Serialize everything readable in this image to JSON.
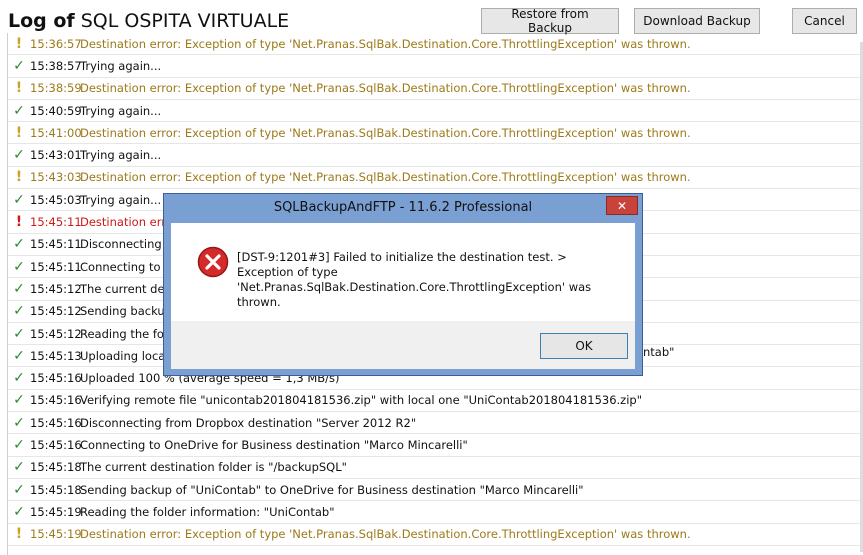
{
  "header": {
    "title_bold": "Log of",
    "title_rest": "SQL OSPITA VIRTUALE",
    "restore_label": "Restore from Backup",
    "download_label": "Download Backup",
    "cancel_label": "Cancel"
  },
  "log": [
    {
      "status": "warning",
      "time": "15:36:57",
      "text": "Destination error: Exception of type 'Net.Pranas.SqlBak.Destination.Core.ThrottlingException' was thrown."
    },
    {
      "status": "ok",
      "time": "15:38:57",
      "text": "Trying again..."
    },
    {
      "status": "warning",
      "time": "15:38:59",
      "text": "Destination error: Exception of type 'Net.Pranas.SqlBak.Destination.Core.ThrottlingException' was thrown."
    },
    {
      "status": "ok",
      "time": "15:40:59",
      "text": "Trying again..."
    },
    {
      "status": "warning",
      "time": "15:41:00",
      "text": "Destination error: Exception of type 'Net.Pranas.SqlBak.Destination.Core.ThrottlingException' was thrown."
    },
    {
      "status": "ok",
      "time": "15:43:01",
      "text": "Trying again..."
    },
    {
      "status": "warning",
      "time": "15:43:03",
      "text": "Destination error: Exception of type 'Net.Pranas.SqlBak.Destination.Core.ThrottlingException' was thrown."
    },
    {
      "status": "ok",
      "time": "15:45:03",
      "text": "Trying again..."
    },
    {
      "status": "error",
      "time": "15:45:11",
      "text": "Destination erro"
    },
    {
      "status": "ok",
      "time": "15:45:11",
      "text": "Disconnecting f"
    },
    {
      "status": "ok",
      "time": "15:45:11",
      "text": "Connecting to D"
    },
    {
      "status": "ok",
      "time": "15:45:12",
      "text": "The current des"
    },
    {
      "status": "ok",
      "time": "15:45:12",
      "text": "Sending backup"
    },
    {
      "status": "ok",
      "time": "15:45:12",
      "text": "Reading the fold"
    },
    {
      "status": "ok",
      "time": "15:45:13",
      "text": "Uploading loca"
    },
    {
      "status": "ok",
      "time": "15:45:16",
      "text": "Uploaded 100 % (average speed = 1,3 MB/s)"
    },
    {
      "status": "ok",
      "time": "15:45:16",
      "text": "Verifying remote file \"unicontab201804181536.zip\" with local one \"UniContab201804181536.zip\""
    },
    {
      "status": "ok",
      "time": "15:45:16",
      "text": "Disconnecting from Dropbox destination \"Server 2012 R2\""
    },
    {
      "status": "ok",
      "time": "15:45:16",
      "text": "Connecting to OneDrive for Business destination \"Marco Mincarelli\""
    },
    {
      "status": "ok",
      "time": "15:45:18",
      "text": "The current destination folder is \"/backupSQL\""
    },
    {
      "status": "ok",
      "time": "15:45:18",
      "text": "Sending backup of \"UniContab\" to OneDrive for Business destination \"Marco Mincarelli\""
    },
    {
      "status": "ok",
      "time": "15:45:19",
      "text": "Reading the folder information: \"UniContab\""
    },
    {
      "status": "warning",
      "time": "15:45:19",
      "text": "Destination error: Exception of type 'Net.Pranas.SqlBak.Destination.Core.ThrottlingException' was thrown."
    }
  ],
  "partial_text": "ntab\"",
  "dialog": {
    "title": "SQLBackupAndFTP - 11.6.2 Professional",
    "close_glyph": "✕",
    "message": "[DST-9:1201#3] Failed to initialize the destination test. > Exception of type 'Net.Pranas.SqlBak.Destination.Core.ThrottlingException' was thrown.",
    "ok_label": "OK"
  },
  "icons": {
    "ok": "✓",
    "warning": "!",
    "error": "!"
  },
  "colors": {
    "ok": "#2d8a2d",
    "warning": "#9c7a1a",
    "error": "#d01818",
    "dialog_frame": "#7a9fd3",
    "close_button": "#c7433b"
  }
}
